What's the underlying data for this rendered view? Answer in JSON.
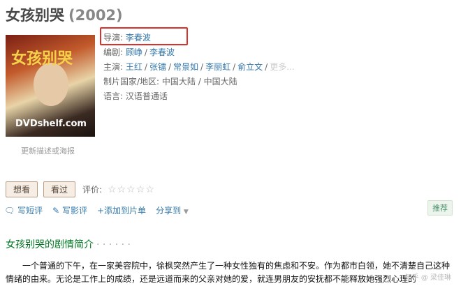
{
  "title": {
    "name": "女孩别哭",
    "year": "(2002)"
  },
  "poster": {
    "logo_text": "女孩别哭",
    "overlay_text": "DVDshelf.com"
  },
  "update_link": "更新描述或海报",
  "info": {
    "director_label": "导演:",
    "director": "李春波",
    "writer_label": "编剧:",
    "writers": [
      "顾峥",
      "李春波"
    ],
    "cast_label": "主演:",
    "cast": [
      "王红",
      "张镭",
      "常景如",
      "李丽虹",
      "俞立文"
    ],
    "cast_more": "更多...",
    "country_label": "制片国家/地区:",
    "country": "中国大陆 / 中国大陆",
    "language_label": "语言:",
    "language": "汉语普通话"
  },
  "buttons": {
    "want": "想看",
    "seen": "看过",
    "rating_label": "评价:",
    "stars": "☆☆☆☆☆"
  },
  "actions": {
    "short_review": "写短评",
    "review": "写影评",
    "add_list": "添加到片单",
    "share": "分享到",
    "recommend": "推荐"
  },
  "section_title": "女孩别哭的剧情简介",
  "section_dots": "· · · · · ·",
  "synopsis": "一个普通的下午，在一家美容院中，徐枫突然产生了一种女性独有的焦虑和不安。作为都市白领，她不清楚自己这种情绪的由来。无论是工作上的成绩，还是远道而来的父亲对她的爱，就连男朋友的安抚都不能释放她强烈心理的",
  "watermark": "知乎 @ 梁佳琳"
}
